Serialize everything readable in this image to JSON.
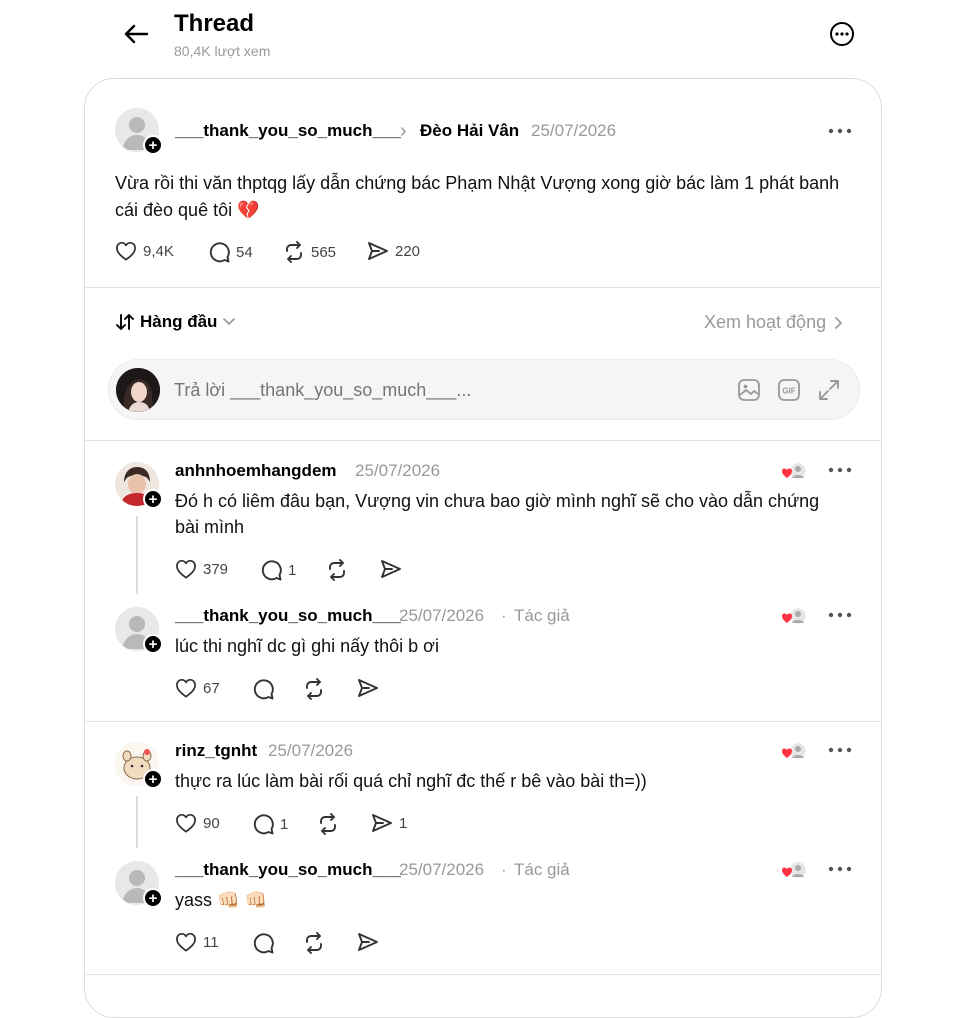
{
  "header": {
    "title": "Thread",
    "views": "80,4K lượt xem"
  },
  "post": {
    "username": "___thank_you_so_much___",
    "chevron": "›",
    "location": "Đèo Hải Vân",
    "date": "25/07/2026",
    "text": "Vừa rồi thi văn thptqg lấy dẫn chứng bác Phạm Nhật Vượng xong giờ bác làm 1 phát banh cái đèo quê tôi",
    "emoji": "💔",
    "likes": "9,4K",
    "comments": "54",
    "reposts": "565",
    "shares": "220"
  },
  "sort": {
    "label": "Hàng đầu",
    "activity_link": "Xem hoạt động"
  },
  "reply_box": {
    "placeholder": "Trả lời ___thank_you_so_much___..."
  },
  "replies": [
    {
      "username": "anhnhoemhangdem",
      "date": "25/07/2026",
      "author_tag": "",
      "text": "Đó h có liêm đâu bạn, Vượng vin chưa bao giờ mình nghĩ sẽ cho vào dẫn chứng bài mình",
      "likes": "379",
      "comments": "1",
      "reposts": "",
      "shares": ""
    },
    {
      "username": "___thank_you_so_much___",
      "date": "25/07/2026",
      "separator": "·",
      "author_tag": "Tác giả",
      "text": "lúc thi nghĩ dc gì ghi nấy thôi b ơi",
      "likes": "67",
      "comments": "",
      "reposts": "",
      "shares": ""
    },
    {
      "username": "rinz_tgnht",
      "date": "25/07/2026",
      "author_tag": "",
      "text": "thực ra lúc làm bài rối quá chỉ nghĩ đc thế r bê vào bài th=))",
      "likes": "90",
      "comments": "1",
      "reposts": "",
      "shares": "1"
    },
    {
      "username": "___thank_you_so_much___",
      "date": "25/07/2026",
      "separator": "·",
      "author_tag": "Tác giả",
      "text": "yass",
      "emoji": "👊🏻 👊🏻",
      "likes": "11",
      "comments": "",
      "reposts": "",
      "shares": ""
    }
  ],
  "colors": {
    "text": "#000000",
    "muted": "#999999",
    "border": "#dcdcdc",
    "heart_red": "#ff3040",
    "input_bg": "#f5f5f5"
  },
  "icons": [
    "back-arrow-icon",
    "more-circle-icon",
    "more-dots-icon",
    "heart-icon",
    "comment-icon",
    "repost-icon",
    "share-icon",
    "sort-icon",
    "chevron-down-icon",
    "chevron-right-icon",
    "image-icon",
    "gif-icon",
    "expand-icon",
    "plus-icon",
    "liked-by-author-icon"
  ]
}
